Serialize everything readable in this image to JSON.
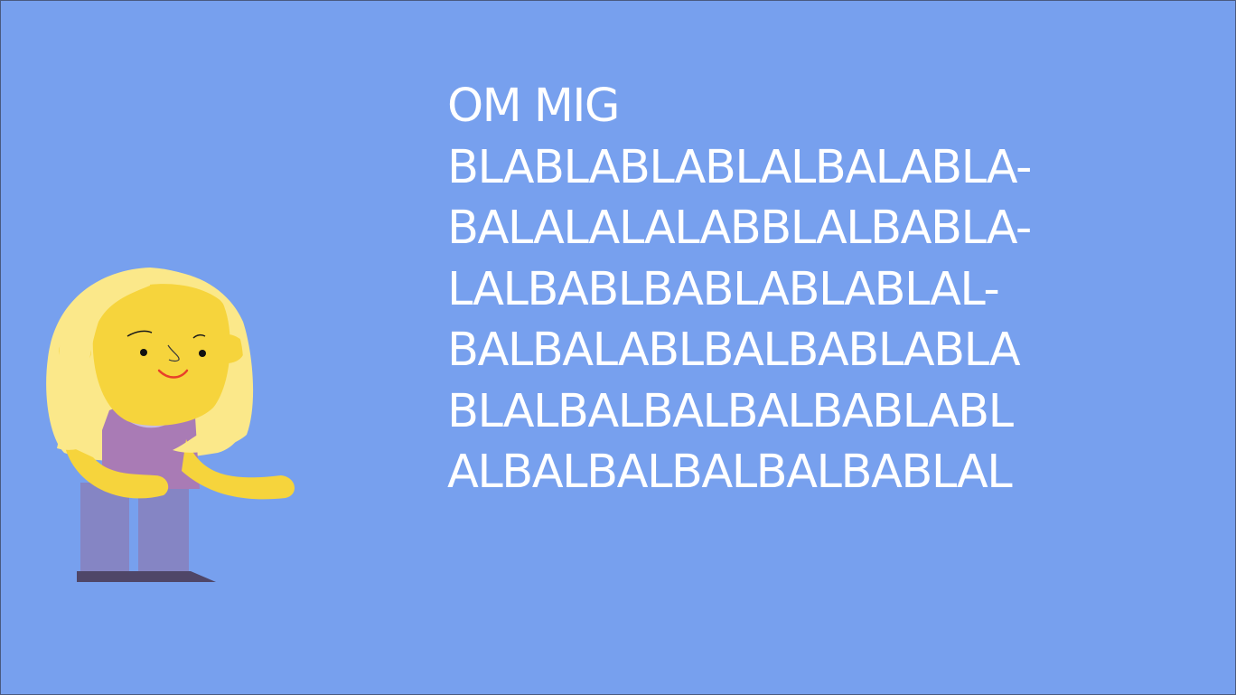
{
  "heading": "OM MIG",
  "body_lines": [
    "BLABLABLABLALBALABLA-",
    "BALALALALABBLALBABLA-",
    "LALBABLBABLABLABLAL-",
    "BALBALABLBALBABLABLA",
    "BLALBALBALBALBABLABL",
    "ALBALBALBALBALBABLAL"
  ],
  "illustration": {
    "name": "girl-character-illustration",
    "colors": {
      "background": "#77a0ee",
      "skin": "#f6d43c",
      "hair": "#fbe88a",
      "shirt": "#a97bb5",
      "pants": "#8585c4",
      "shoes": "#4f4668",
      "smile": "#e8402a"
    }
  }
}
